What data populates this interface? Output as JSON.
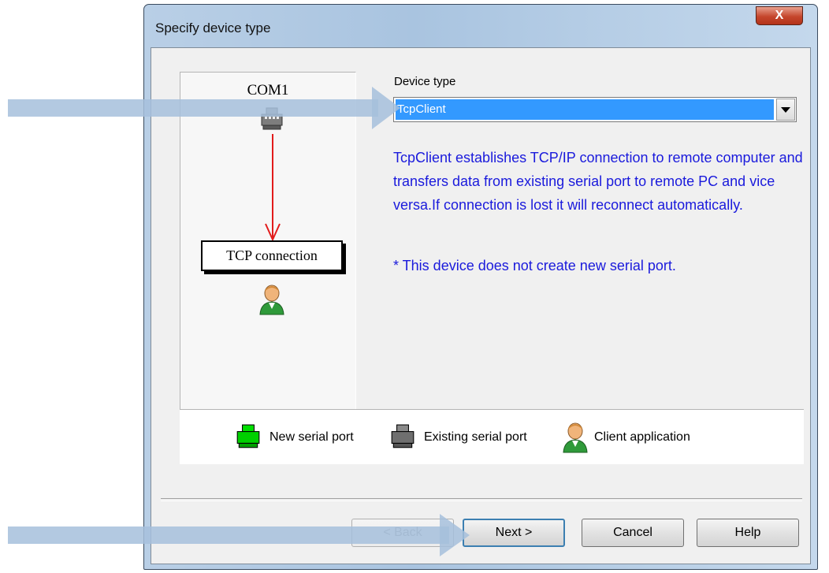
{
  "window": {
    "title": "Specify device type",
    "close_label": "X"
  },
  "diagram": {
    "port_label": "COM1",
    "connection_label": "TCP connection"
  },
  "device_type": {
    "label": "Device type",
    "selected": "TcpClient"
  },
  "description": "TcpClient establishes TCP/IP connection to remote computer and transfers data from existing serial port to remote PC and vice versa.If connection is lost it will reconnect automatically.",
  "note": "* This device does not create new serial port.",
  "legend": {
    "new_port": "New serial port",
    "existing_port": "Existing serial port",
    "client_app": "Client application"
  },
  "buttons": {
    "back": "< Back",
    "next": "Next >",
    "cancel": "Cancel",
    "help": "Help"
  },
  "colors": {
    "accent_blue": "#3399ff",
    "description_text": "#1a1adc",
    "arrow_line": "#e21b1b",
    "overlay_arrow": "#a6bfdc",
    "new_port_icon": "#00e000",
    "existing_port_icon": "#6f6f6f"
  }
}
